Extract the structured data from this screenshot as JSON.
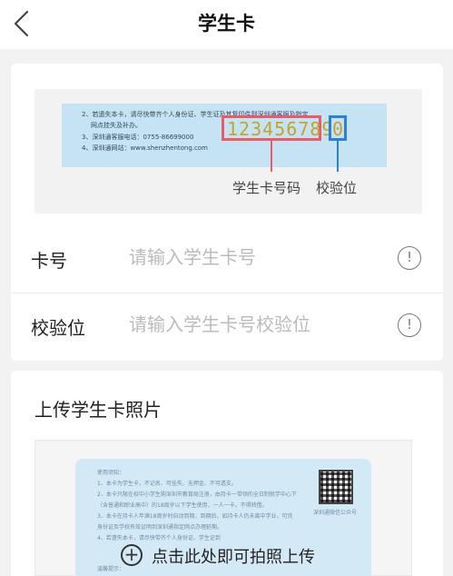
{
  "header": {
    "title": "学生卡"
  },
  "sample_card": {
    "notes": [
      "2、若遗失本卡，请尽快带齐个人身份证、学生证及其复印件到深圳通客服及指定",
      "网点挂失及补办。",
      "3、深圳通客服电话：0755-86699000",
      "4、深圳通网站：www.shenzhentong.com"
    ],
    "card_number": "123456789",
    "check_digit": "0",
    "callout_number_label": "学生卡号码",
    "callout_check_label": "校验位"
  },
  "form": {
    "card_number": {
      "label": "卡号",
      "placeholder": "请输入学生卡号",
      "value": ""
    },
    "check_digit": {
      "label": "校验位",
      "placeholder": "请输入学生卡号校验位",
      "value": ""
    }
  },
  "upload": {
    "title": "上传学生卡照片",
    "action_text": "点击此处即可拍照上传",
    "sample_lines": [
      "使用须知：",
      "1、本卡为学生卡，不记名、可挂失、无押金、不可透支。",
      "2、本卡只限在校中小学生购深圳市教育局注册，由持卡一带领的全日制就学中心下",
      "（含普通和职业高中）的18周岁以下学生使用，一人一卡，不得转借。",
      "3、本卡在持卡人年满18周岁时自动到期，到期后，如持卡人仍未离中学业，可凭",
      "身份证及学校有效证明到深圳通指定网点办理延期。",
      "4、若遗失本卡，请尽快带齐个人身份证、学生证到",
      "温馨提示："
    ],
    "qr_label": "深圳通微信公众号"
  },
  "colors": {
    "accent_red": "#e35d6a",
    "accent_blue": "#2e7fd6",
    "card_gold": "#c8a22a"
  }
}
